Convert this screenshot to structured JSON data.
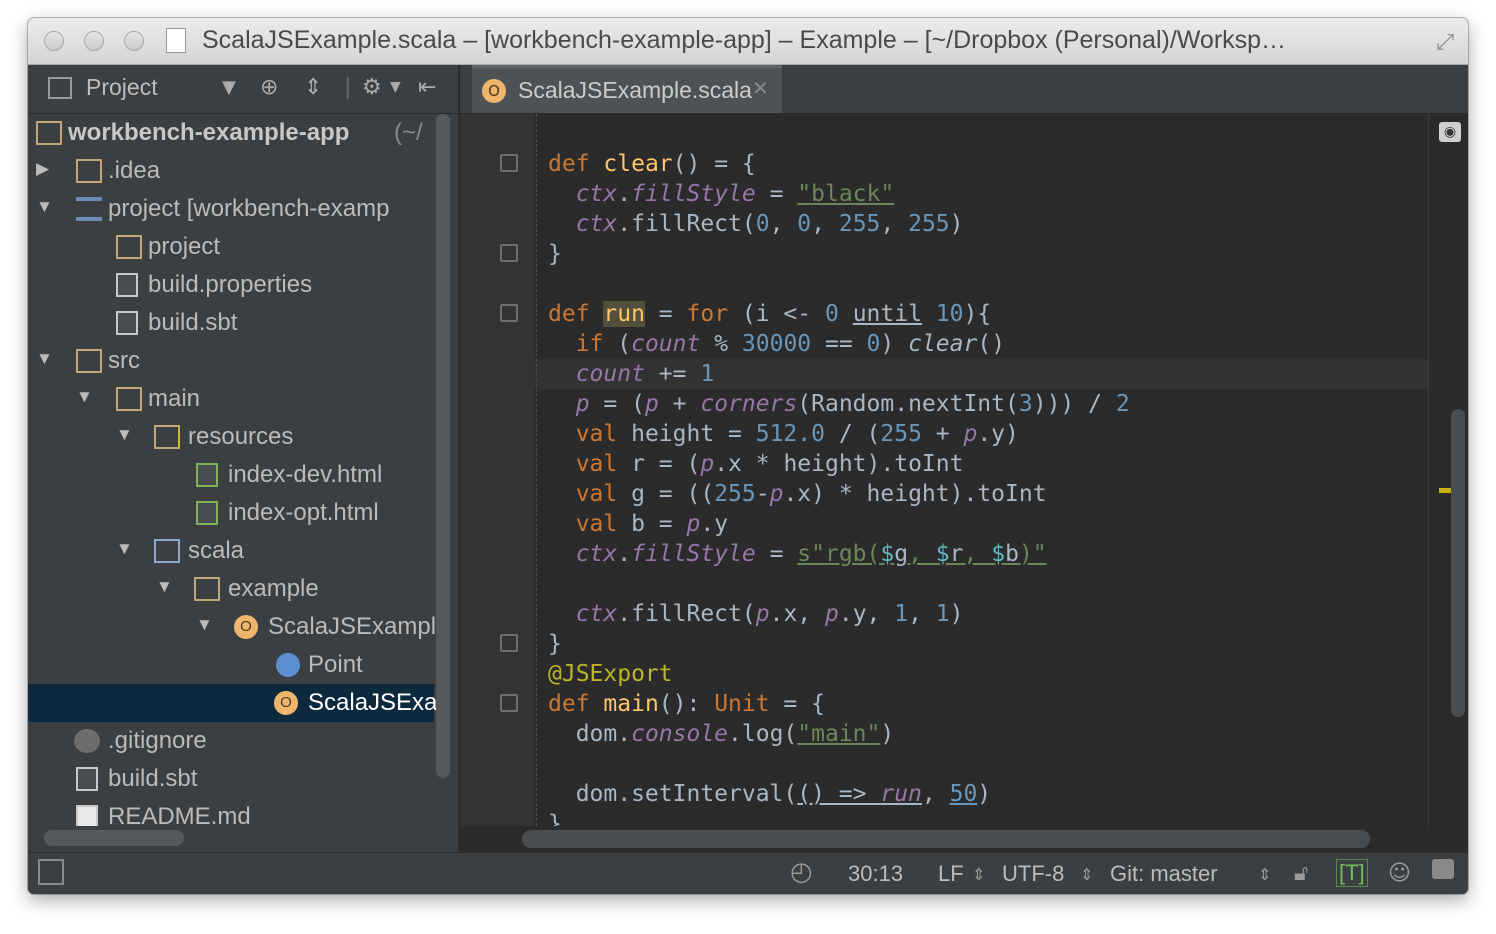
{
  "window": {
    "title": "ScalaJSExample.scala – [workbench-example-app] – Example – [~/Dropbox (Personal)/Worksp…"
  },
  "project_panel": {
    "view_label": "Project",
    "tree": [
      {
        "label": "workbench-example-app",
        "suffix": "(~/",
        "icon": "module-folder-icon",
        "expanded": true
      },
      {
        "label": ".idea",
        "icon": "folder-icon",
        "expanded": false
      },
      {
        "label": "project [workbench-examp",
        "icon": "sbt-module-icon",
        "expanded": true
      },
      {
        "label": "project",
        "icon": "package-folder-icon"
      },
      {
        "label": "build.properties",
        "icon": "properties-file-icon"
      },
      {
        "label": "build.sbt",
        "icon": "sbt-file-icon"
      },
      {
        "label": "src",
        "icon": "folder-icon",
        "expanded": true
      },
      {
        "label": "main",
        "icon": "folder-icon",
        "expanded": true
      },
      {
        "label": "resources",
        "icon": "resources-folder-icon",
        "expanded": true
      },
      {
        "label": "index-dev.html",
        "icon": "html-file-icon"
      },
      {
        "label": "index-opt.html",
        "icon": "html-file-icon"
      },
      {
        "label": "scala",
        "icon": "source-folder-icon",
        "expanded": true
      },
      {
        "label": "example",
        "icon": "package-folder-icon",
        "expanded": true
      },
      {
        "label": "ScalaJSExampl",
        "icon": "scala-object-icon",
        "expanded": true
      },
      {
        "label": "Point",
        "icon": "case-class-icon"
      },
      {
        "label": "ScalaJSExar",
        "icon": "scala-object-icon",
        "selected": true
      },
      {
        "label": ".gitignore",
        "icon": "git-file-icon"
      },
      {
        "label": "build.sbt",
        "icon": "sbt-file-icon"
      },
      {
        "label": "README.md",
        "icon": "markdown-file-icon"
      }
    ]
  },
  "editor": {
    "tab_label": "ScalaJSExample.scala",
    "tab_icon_letter": "O",
    "code_lines": [
      "def clear() = {",
      "  ctx.fillStyle = \"black\"",
      "  ctx.fillRect(0, 0, 255, 255)",
      "}",
      "",
      "def run = for (i <- 0 until 10){",
      "  if (count % 30000 == 0) clear()",
      "  count += 1",
      "  p = (p + corners(Random.nextInt(3))) / 2",
      "  val height = 512.0 / (255 + p.y)",
      "  val r = (p.x * height).toInt",
      "  val g = ((255-p.x) * height).toInt",
      "  val b = p.y",
      "  ctx.fillStyle = s\"rgb($g, $r, $b)\"",
      "",
      "  ctx.fillRect(p.x, p.y, 1, 1)",
      "}",
      "@JSExport",
      "def main(): Unit = {",
      "  dom.console.log(\"main\")",
      "",
      "  dom.setInterval(() => run, 50)",
      "}"
    ]
  },
  "status_bar": {
    "position": "30:13",
    "line_separator": "LF",
    "encoding": "UTF-8",
    "vcs": "Git: master",
    "mode_badge": "[T]"
  },
  "colors": {
    "keyword": "#cc7832",
    "function": "#ffc66d",
    "number": "#6897bb",
    "string": "#6a8759",
    "field": "#9876aa",
    "annotation": "#bbb529",
    "editor_bg": "#2b2b2b",
    "panel_bg": "#3c3f41",
    "selection": "#0d293e"
  }
}
